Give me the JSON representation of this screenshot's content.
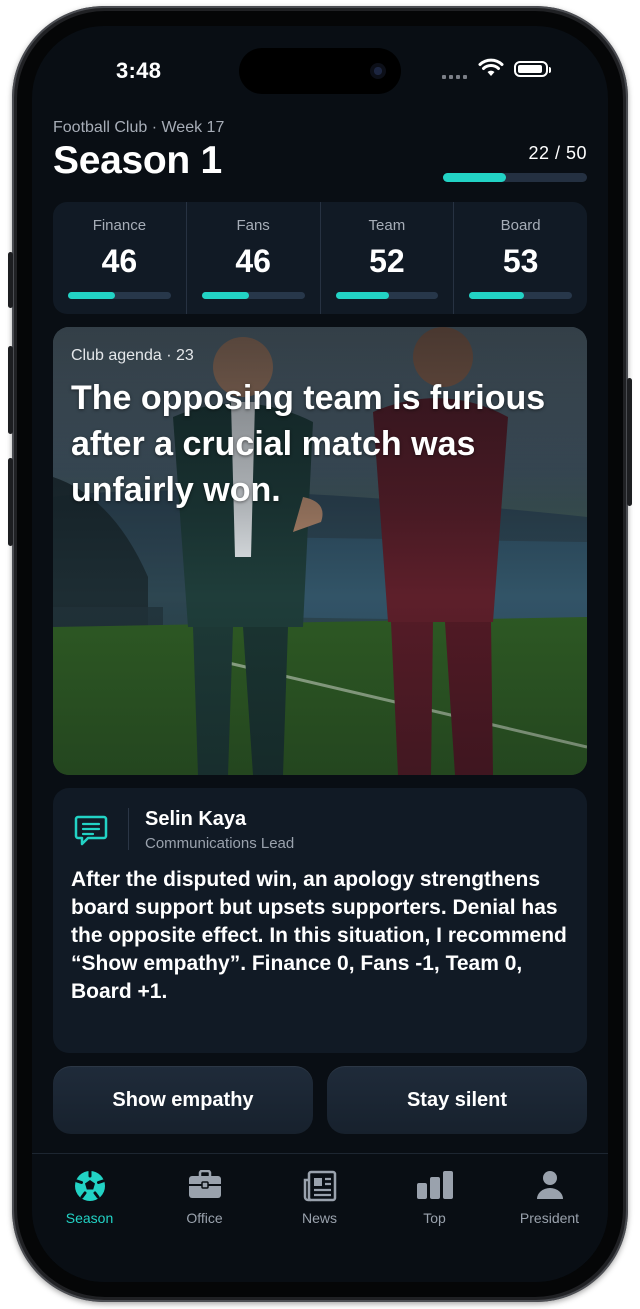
{
  "status_bar": {
    "time": "3:48"
  },
  "header": {
    "subtitle": "Football Club · Week 17",
    "title": "Season 1",
    "progress_label": "22 / 50",
    "progress_fraction": 0.44
  },
  "stats": [
    {
      "label": "Finance",
      "value": "46",
      "fraction": 0.46
    },
    {
      "label": "Fans",
      "value": "46",
      "fraction": 0.46
    },
    {
      "label": "Team",
      "value": "52",
      "fraction": 0.52
    },
    {
      "label": "Board",
      "value": "53",
      "fraction": 0.53
    }
  ],
  "event": {
    "tag": "Club agenda · 23",
    "text": "The opposing team is furious after a crucial match was unfairly won."
  },
  "advisor": {
    "icon": "chat-icon",
    "name": "Selin Kaya",
    "role": "Communications Lead",
    "text": "After the disputed win, an apology strengthens board support but upsets supporters. Denial has the opposite effect. In this situation, I recommend “Show empathy”. Finance 0, Fans -1, Team 0, Board +1."
  },
  "choices": {
    "left": "Show empathy",
    "right": "Stay silent"
  },
  "tabs": [
    {
      "label": "Season",
      "icon": "soccer-ball-icon",
      "active": true
    },
    {
      "label": "Office",
      "icon": "briefcase-icon",
      "active": false
    },
    {
      "label": "News",
      "icon": "newspaper-icon",
      "active": false
    },
    {
      "label": "Top",
      "icon": "bar-chart-icon",
      "active": false
    },
    {
      "label": "President",
      "icon": "person-icon",
      "active": false
    }
  ],
  "colors": {
    "accent": "#22d3c5",
    "background": "#090e14",
    "card": "#111a25"
  }
}
